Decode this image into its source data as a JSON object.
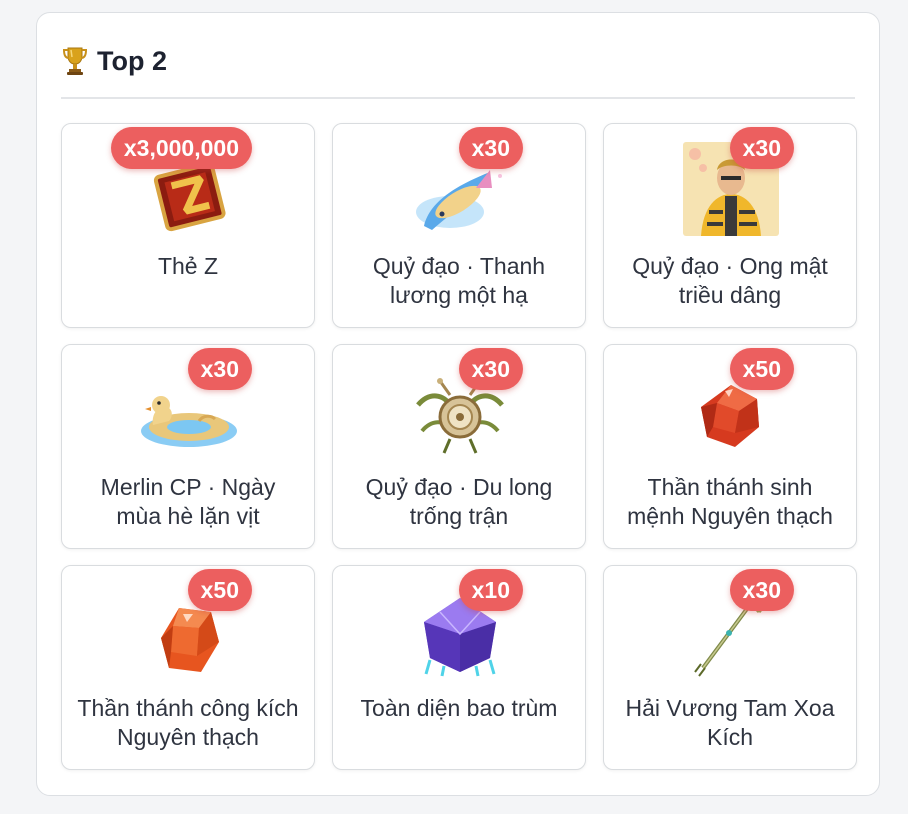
{
  "header": {
    "title": "Top 2",
    "icon": "trophy-icon"
  },
  "colors": {
    "badge": "#ec5f5f",
    "text": "#2f3440",
    "title": "#1d2230"
  },
  "items": [
    {
      "name": "Thẻ Z",
      "qty": "x3,000,000",
      "icon": "z-card-icon"
    },
    {
      "name": "Quỷ đạo · Thanh lương một hạ",
      "qty": "x30",
      "icon": "fish-trail-icon"
    },
    {
      "name": "Quỷ đạo · Ong mật triều dâng",
      "qty": "x30",
      "icon": "bee-character-icon"
    },
    {
      "name": "Merlin CP · Ngày mùa hè lặn vịt",
      "qty": "x30",
      "icon": "duck-float-icon"
    },
    {
      "name": "Quỷ đạo · Du long trống trận",
      "qty": "x30",
      "icon": "war-drum-icon"
    },
    {
      "name": "Thần thánh sinh mệnh Nguyên thạch",
      "qty": "x50",
      "icon": "red-gem-icon"
    },
    {
      "name": "Thần thánh công kích Nguyên thạch",
      "qty": "x50",
      "icon": "orange-gem-icon"
    },
    {
      "name": "Toàn diện bao trùm",
      "qty": "x10",
      "icon": "purple-crystal-icon"
    },
    {
      "name": "Hải Vương Tam Xoa Kích",
      "qty": "x30",
      "icon": "trident-icon"
    }
  ]
}
